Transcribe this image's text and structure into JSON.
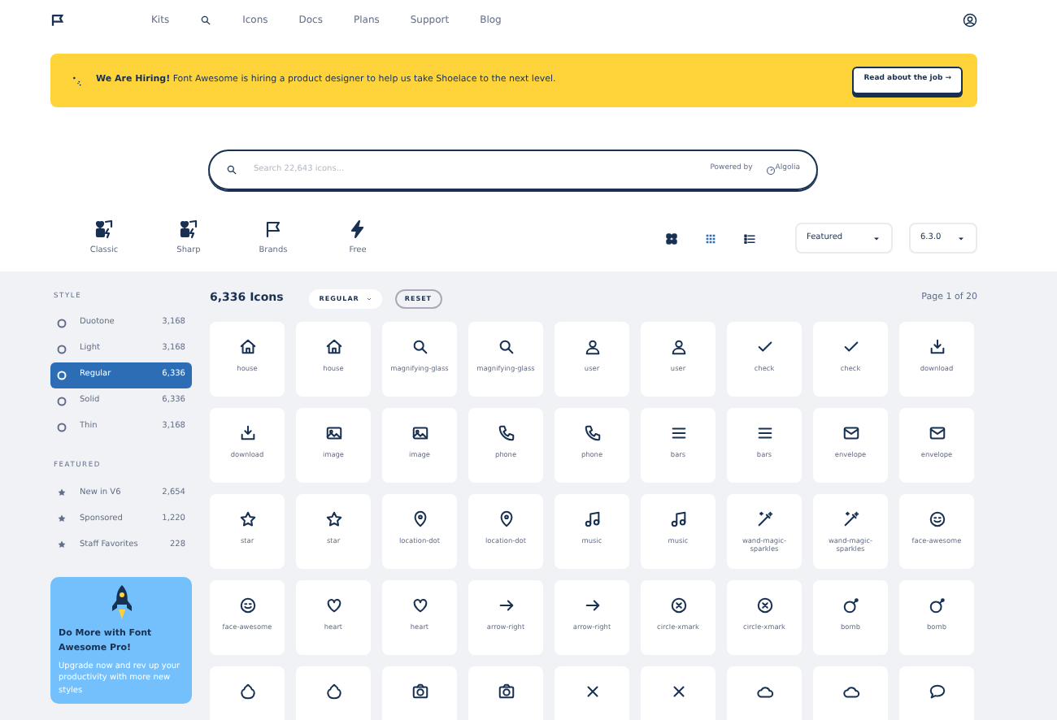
{
  "nav": {
    "items": [
      {
        "label": "Kits",
        "kind": "text"
      },
      {
        "kind": "search"
      },
      {
        "label": "Icons",
        "kind": "text"
      },
      {
        "label": "Docs",
        "kind": "text"
      },
      {
        "label": "Plans",
        "kind": "text"
      },
      {
        "label": "Support",
        "kind": "text"
      },
      {
        "label": "Blog",
        "kind": "text"
      }
    ]
  },
  "banner": {
    "text": "**We Are Hiring!** Font Awesome is hiring a product designer to help us take Shoelace to the next level.",
    "button": "Read about the job →"
  },
  "search": {
    "placeholder": "Search 22,643 icons...",
    "powered_by": "Powered by",
    "provider": "Algolia"
  },
  "families": [
    {
      "label": "Classic",
      "kind": "classic"
    },
    {
      "label": "Sharp",
      "kind": "classic"
    },
    {
      "label": "Brands",
      "kind": "flag"
    },
    {
      "label": "Free",
      "kind": "bolt"
    }
  ],
  "views": [
    {
      "kind": "large",
      "selected": false
    },
    {
      "kind": "grid",
      "selected": true
    },
    {
      "kind": "list",
      "selected": false
    }
  ],
  "sort": {
    "value": "Featured"
  },
  "version": {
    "value": "6.3.0"
  },
  "sidebar": {
    "sections": [
      {
        "title": "STYLE",
        "items": [
          {
            "label": "Duotone",
            "count": "3,168",
            "selected": false
          },
          {
            "label": "Light",
            "count": "3,168",
            "selected": false
          },
          {
            "label": "Regular",
            "count": "6,336",
            "selected": true
          },
          {
            "label": "Solid",
            "count": "6,336",
            "selected": false
          },
          {
            "label": "Thin",
            "count": "3,168",
            "selected": false
          }
        ]
      },
      {
        "title": "FEATURED",
        "items": [
          {
            "label": "New in V6",
            "count": "2,654",
            "selected": false
          },
          {
            "label": "Sponsored",
            "count": "1,220",
            "selected": false
          },
          {
            "label": "Staff Favorites",
            "count": "228",
            "selected": false
          }
        ]
      }
    ],
    "promo": {
      "title": "Do More with Font Awesome Pro!",
      "text": "Upgrade now and rev up your productivity with more new styles"
    }
  },
  "results": {
    "count": "6,336 Icons",
    "filter": "REGULAR",
    "reset": "RESET",
    "page": "Page 1 of 20"
  },
  "icons": [
    {
      "kind": "house",
      "label": "house"
    },
    {
      "kind": "house",
      "label": "house"
    },
    {
      "kind": "search",
      "label": "magnifying-glass"
    },
    {
      "kind": "search",
      "label": "magnifying-glass"
    },
    {
      "kind": "user",
      "label": "user"
    },
    {
      "kind": "user",
      "label": "user"
    },
    {
      "kind": "check",
      "label": "check"
    },
    {
      "kind": "check",
      "label": "check"
    },
    {
      "kind": "download",
      "label": "download"
    },
    {
      "kind": "download",
      "label": "download"
    },
    {
      "kind": "image",
      "label": "image"
    },
    {
      "kind": "image",
      "label": "image"
    },
    {
      "kind": "phone",
      "label": "phone"
    },
    {
      "kind": "phone",
      "label": "phone"
    },
    {
      "kind": "bars",
      "label": "bars"
    },
    {
      "kind": "bars",
      "label": "bars"
    },
    {
      "kind": "envelope",
      "label": "envelope"
    },
    {
      "kind": "envelope",
      "label": "envelope"
    },
    {
      "kind": "star",
      "label": "star"
    },
    {
      "kind": "star",
      "label": "star"
    },
    {
      "kind": "pin",
      "label": "location-dot"
    },
    {
      "kind": "pin",
      "label": "location-dot"
    },
    {
      "kind": "music",
      "label": "music"
    },
    {
      "kind": "music",
      "label": "music"
    },
    {
      "kind": "wand",
      "label": "wand-magic-sparkles"
    },
    {
      "kind": "wand",
      "label": "wand-magic-sparkles"
    },
    {
      "kind": "face",
      "label": "face-awesome"
    },
    {
      "kind": "face",
      "label": "face-awesome"
    },
    {
      "kind": "heart",
      "label": "heart"
    },
    {
      "kind": "heart",
      "label": "heart"
    },
    {
      "kind": "arrow",
      "label": "arrow-right"
    },
    {
      "kind": "arrow",
      "label": "arrow-right"
    },
    {
      "kind": "xcircle",
      "label": "circle-xmark"
    },
    {
      "kind": "xcircle",
      "label": "circle-xmark"
    },
    {
      "kind": "bomb",
      "label": "bomb"
    },
    {
      "kind": "bomb",
      "label": "bomb"
    },
    {
      "kind": "poo"
    },
    {
      "kind": "poo"
    },
    {
      "kind": "camera"
    },
    {
      "kind": "camera"
    },
    {
      "kind": "xmark"
    },
    {
      "kind": "xmark"
    },
    {
      "kind": "cloud"
    },
    {
      "kind": "cloud"
    },
    {
      "kind": "comment"
    }
  ]
}
